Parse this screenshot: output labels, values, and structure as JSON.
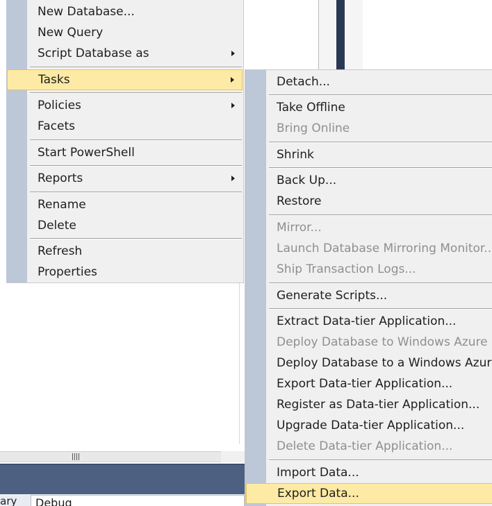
{
  "background": {
    "properties_row": {
      "label": "rary",
      "combo_value": "Debug"
    }
  },
  "context_menu": {
    "items": [
      {
        "id": "new-database",
        "label": "New Database..."
      },
      {
        "id": "new-query",
        "label": "New Query"
      },
      {
        "id": "script-database-as",
        "label": "Script Database as",
        "submenu": true
      },
      {
        "id": "tasks",
        "label": "Tasks",
        "submenu": true,
        "highlighted": true
      },
      {
        "id": "policies",
        "label": "Policies",
        "submenu": true
      },
      {
        "id": "facets",
        "label": "Facets"
      },
      {
        "id": "start-powershell",
        "label": "Start PowerShell"
      },
      {
        "id": "reports",
        "label": "Reports",
        "submenu": true
      },
      {
        "id": "rename",
        "label": "Rename"
      },
      {
        "id": "delete",
        "label": "Delete"
      },
      {
        "id": "refresh",
        "label": "Refresh"
      },
      {
        "id": "properties",
        "label": "Properties"
      }
    ]
  },
  "tasks_submenu": {
    "items": [
      {
        "id": "detach",
        "label": "Detach..."
      },
      {
        "id": "take-offline",
        "label": "Take Offline"
      },
      {
        "id": "bring-online",
        "label": "Bring Online",
        "disabled": true
      },
      {
        "id": "shrink",
        "label": "Shrink"
      },
      {
        "id": "back-up",
        "label": "Back Up..."
      },
      {
        "id": "restore",
        "label": "Restore"
      },
      {
        "id": "mirror",
        "label": "Mirror...",
        "disabled": true
      },
      {
        "id": "launch-mirroring-monitor",
        "label": "Launch Database Mirroring Monitor...",
        "disabled": true
      },
      {
        "id": "ship-transaction-logs",
        "label": "Ship Transaction Logs...",
        "disabled": true
      },
      {
        "id": "generate-scripts",
        "label": "Generate Scripts..."
      },
      {
        "id": "extract-data-tier",
        "label": "Extract Data-tier Application..."
      },
      {
        "id": "deploy-azure-sql",
        "label": "Deploy Database to Windows Azure SQL Database...",
        "disabled": true
      },
      {
        "id": "deploy-azure-vm",
        "label": "Deploy Database to a Windows Azure VM..."
      },
      {
        "id": "export-data-tier",
        "label": "Export Data-tier Application..."
      },
      {
        "id": "register-data-tier",
        "label": "Register as Data-tier Application..."
      },
      {
        "id": "upgrade-data-tier",
        "label": "Upgrade Data-tier Application..."
      },
      {
        "id": "delete-data-tier",
        "label": "Delete Data-tier Application...",
        "disabled": true
      },
      {
        "id": "import-data",
        "label": "Import Data..."
      },
      {
        "id": "export-data",
        "label": "Export Data...",
        "highlighted": true
      }
    ]
  },
  "colors": {
    "menu_background": "#f0f0f0",
    "menu_gutter": "#bcc7d8",
    "highlight_fill": "#fdeaa4",
    "highlight_border": "#e8c455",
    "disabled_text": "#8f8f8f",
    "title_bar": "#4d6082"
  }
}
